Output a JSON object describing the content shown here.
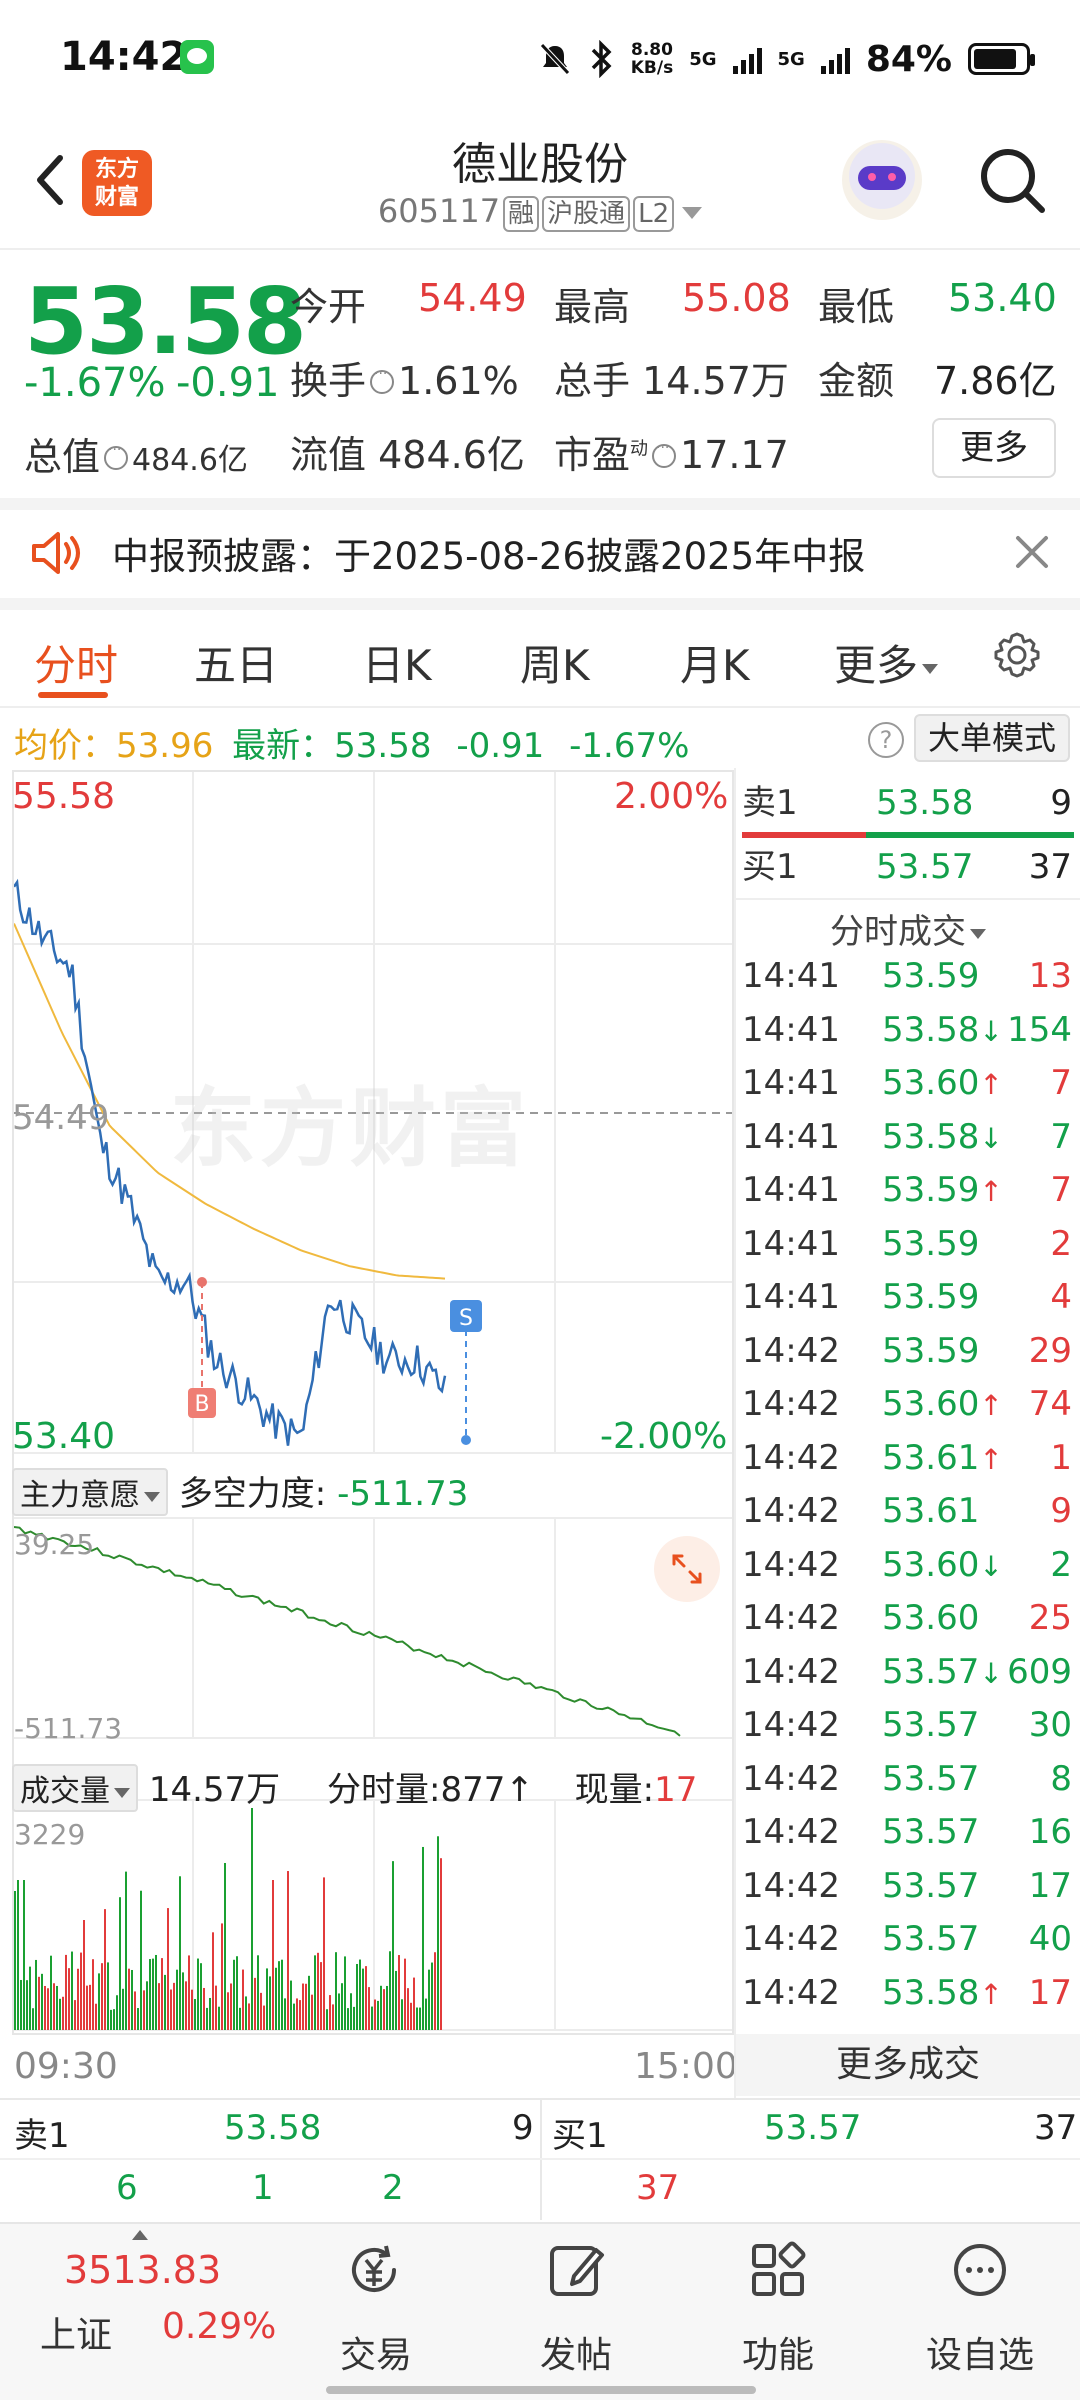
{
  "status": {
    "time": "14:42",
    "speed_top": "8.80",
    "speed_unit": "KB/s",
    "battery": "84%",
    "net1": "5G",
    "net2": "5G"
  },
  "header": {
    "title": "德业股份",
    "code": "605117",
    "tags": [
      "融",
      "沪股通",
      "L2"
    ],
    "logo": [
      "东方",
      "财富"
    ]
  },
  "quote": {
    "price": "53.58",
    "pct": "-1.67%",
    "change": "-0.91",
    "open_label": "今开",
    "open": "54.49",
    "high_label": "最高",
    "high": "55.08",
    "low_label": "最低",
    "low": "53.40",
    "turnover_label": "换手",
    "turnover": "1.61%",
    "volume_label": "总手",
    "volume": "14.57万",
    "amount_label": "金额",
    "amount": "7.86亿",
    "mcap_label": "总值",
    "mcap": "484.6亿",
    "float_label": "流值",
    "float": "484.6亿",
    "pe_label": "市盈",
    "pe_sup": "动",
    "pe": "17.17",
    "more": "更多"
  },
  "notice": {
    "text": "中报预披露：于2025-08-26披露2025年中报"
  },
  "tabs": [
    "分时",
    "五日",
    "日K",
    "周K",
    "月K",
    "更多"
  ],
  "summary": {
    "avg_label": "均价：",
    "avg": "53.96",
    "last_label": "最新：",
    "last": "53.58",
    "chg": "-0.91",
    "pct": "-1.67%",
    "help": "?",
    "bigorder": "大单模式"
  },
  "chart": {
    "top_left": "55.58",
    "top_right": "2.00%",
    "bot_left": "53.40",
    "bot_right": "-2.00%",
    "mid": "54.49",
    "watermark": "东方财富",
    "marker_b": "B",
    "marker_s": "S",
    "ind_select": "主力意愿",
    "ind_name": "多空力度:",
    "ind_value": "-511.73",
    "ind_top": "39.25",
    "ind_bot": "-511.73",
    "vol_select": "成交量",
    "vol_total": "14.57万",
    "vol_min_label": "分时量:",
    "vol_min": "877",
    "vol_now_label": "现量:",
    "vol_now": "17",
    "vol_top": "3229",
    "time_start": "09:30",
    "time_end": "15:00"
  },
  "chart_data": {
    "type": "line",
    "title": "",
    "ylim": [
      53.4,
      55.58
    ],
    "series": [
      {
        "values": [
          55.2,
          55.05,
          54.95,
          54.4,
          54.2,
          53.95,
          53.95,
          53.7,
          53.6,
          53.5,
          53.45,
          53.9,
          53.8,
          53.7,
          53.7,
          53.6
        ]
      },
      {
        "values": [
          55.1,
          54.75,
          54.45,
          54.3,
          54.2,
          54.12,
          54.05,
          54.0,
          53.97,
          53.96
        ]
      }
    ]
  },
  "orderbook_side": {
    "sell1_label": "卖1",
    "sell1_price": "53.58",
    "sell1_vol": "9",
    "buy1_label": "买1",
    "buy1_price": "53.57",
    "buy1_vol": "37"
  },
  "trades_title": "分时成交",
  "trades": [
    {
      "t": "14:41",
      "p": "53.59",
      "a": "",
      "v": "13"
    },
    {
      "t": "14:41",
      "p": "53.58",
      "a": "↓",
      "v": "154"
    },
    {
      "t": "14:41",
      "p": "53.60",
      "a": "↑",
      "v": "7"
    },
    {
      "t": "14:41",
      "p": "53.58",
      "a": "↓",
      "v": "7"
    },
    {
      "t": "14:41",
      "p": "53.59",
      "a": "↑",
      "v": "7"
    },
    {
      "t": "14:41",
      "p": "53.59",
      "a": "",
      "v": "2"
    },
    {
      "t": "14:41",
      "p": "53.59",
      "a": "",
      "v": "4"
    },
    {
      "t": "14:42",
      "p": "53.59",
      "a": "",
      "v": "29"
    },
    {
      "t": "14:42",
      "p": "53.60",
      "a": "↑",
      "v": "74"
    },
    {
      "t": "14:42",
      "p": "53.61",
      "a": "↑",
      "v": "1"
    },
    {
      "t": "14:42",
      "p": "53.61",
      "a": "",
      "v": "9"
    },
    {
      "t": "14:42",
      "p": "53.60",
      "a": "↓",
      "v": "2"
    },
    {
      "t": "14:42",
      "p": "53.60",
      "a": "",
      "v": "25"
    },
    {
      "t": "14:42",
      "p": "53.57",
      "a": "↓",
      "v": "609"
    },
    {
      "t": "14:42",
      "p": "53.57",
      "a": "",
      "v": "30"
    },
    {
      "t": "14:42",
      "p": "53.57",
      "a": "",
      "v": "8"
    },
    {
      "t": "14:42",
      "p": "53.57",
      "a": "",
      "v": "16"
    },
    {
      "t": "14:42",
      "p": "53.57",
      "a": "",
      "v": "17"
    },
    {
      "t": "14:42",
      "p": "53.57",
      "a": "",
      "v": "40"
    },
    {
      "t": "14:42",
      "p": "53.58",
      "a": "↑",
      "v": "17"
    }
  ],
  "more_trades": "更多成交",
  "bottom_book": {
    "sell_label": "卖1",
    "sell_price": "53.58",
    "sell_vol": "9",
    "buy_label": "买1",
    "buy_price": "53.57",
    "buy_vol": "37",
    "sell_detail": [
      "6",
      "1",
      "2"
    ],
    "buy_detail": [
      "37"
    ]
  },
  "nav": {
    "index_value": "3513.83",
    "index_name": "上证",
    "index_pct": "0.29%",
    "items": [
      "交易",
      "发帖",
      "功能",
      "设自选"
    ]
  }
}
